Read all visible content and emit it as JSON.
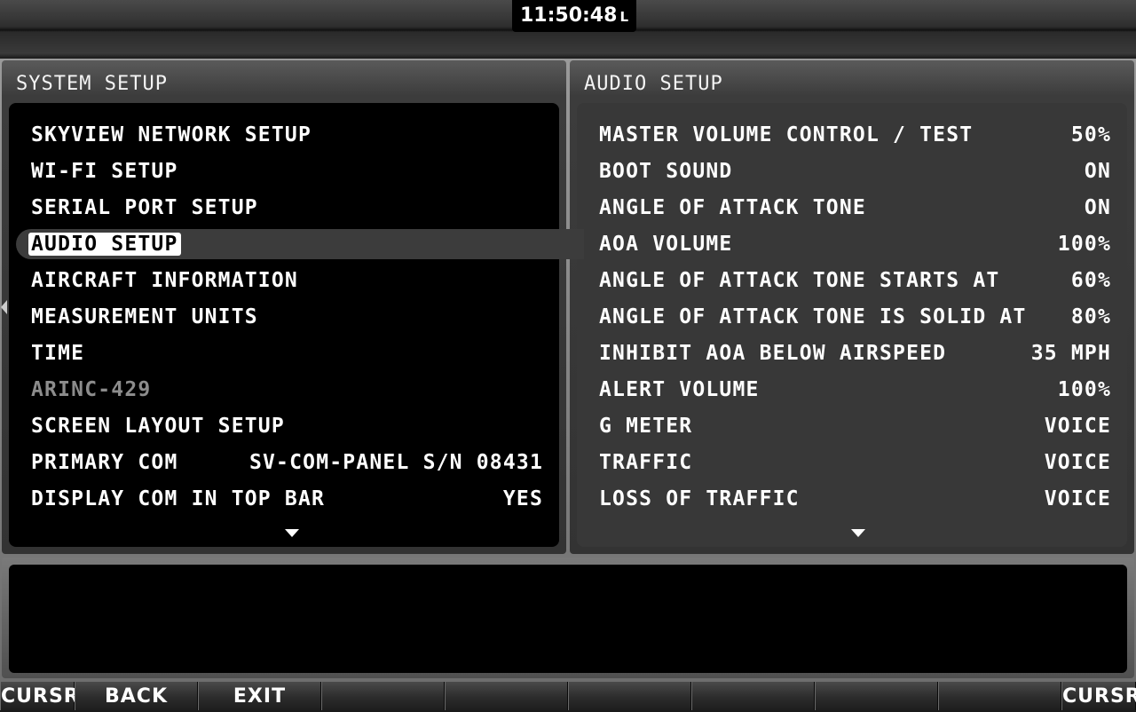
{
  "clock": {
    "time": "11:50:48",
    "zone": "L"
  },
  "left_panel": {
    "title": "SYSTEM SETUP",
    "items": [
      {
        "label": "SKYVIEW NETWORK SETUP",
        "value": ""
      },
      {
        "label": "WI-FI SETUP",
        "value": ""
      },
      {
        "label": "SERIAL PORT SETUP",
        "value": ""
      },
      {
        "label": "AUDIO SETUP",
        "value": ""
      },
      {
        "label": "AIRCRAFT INFORMATION",
        "value": ""
      },
      {
        "label": "MEASUREMENT UNITS",
        "value": ""
      },
      {
        "label": "TIME",
        "value": ""
      },
      {
        "label": "ARINC-429",
        "value": ""
      },
      {
        "label": "SCREEN LAYOUT SETUP",
        "value": ""
      },
      {
        "label": "PRIMARY COM",
        "value": "SV-COM-PANEL S/N 08431"
      },
      {
        "label": "DISPLAY COM IN TOP BAR",
        "value": "YES"
      }
    ]
  },
  "right_panel": {
    "title": "AUDIO SETUP",
    "items": [
      {
        "label": "MASTER VOLUME CONTROL / TEST",
        "value": "50%"
      },
      {
        "label": "BOOT SOUND",
        "value": "ON"
      },
      {
        "label": "ANGLE OF ATTACK TONE",
        "value": "ON"
      },
      {
        "label": "AOA VOLUME",
        "value": "100%"
      },
      {
        "label": "ANGLE OF ATTACK TONE STARTS AT",
        "value": "60%"
      },
      {
        "label": "ANGLE OF ATTACK TONE IS SOLID AT",
        "value": "80%"
      },
      {
        "label": "INHIBIT AOA BELOW AIRSPEED",
        "value": "35 MPH"
      },
      {
        "label": "ALERT VOLUME",
        "value": "100%"
      },
      {
        "label": "G METER",
        "value": "VOICE"
      },
      {
        "label": "TRAFFIC",
        "value": "VOICE"
      },
      {
        "label": "LOSS OF TRAFFIC",
        "value": "VOICE"
      }
    ]
  },
  "softkeys": [
    "CURSR",
    "BACK",
    "EXIT",
    "",
    "",
    "",
    "",
    "",
    "CURSR"
  ],
  "colors": {
    "selected_bg": "#ffffff",
    "disabled_text": "#8c8c8c",
    "panel_body_dark": "#000000",
    "panel_body_right": "#383838"
  },
  "icons": {
    "more_below": "down-triangle-icon",
    "side_indicator": "left-caret-icon"
  }
}
